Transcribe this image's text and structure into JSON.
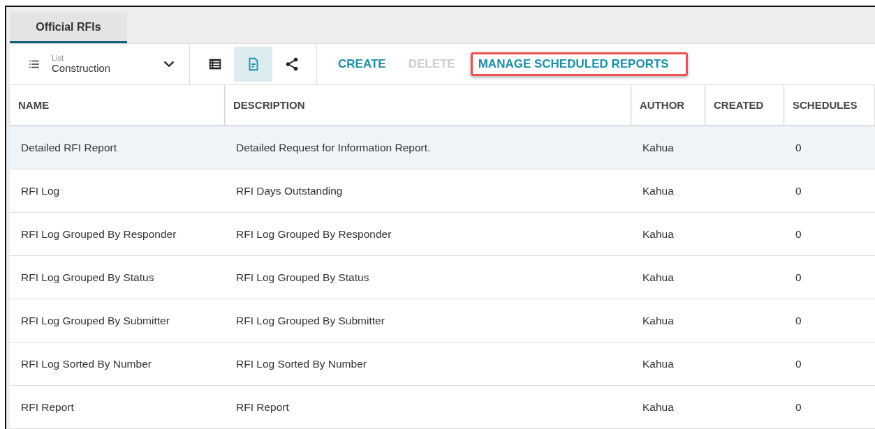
{
  "tabs": [
    {
      "label": "Official RFIs",
      "selected": true
    }
  ],
  "view_picker": {
    "caption": "List",
    "value": "Construction"
  },
  "view_buttons": [
    {
      "kind": "table",
      "selected": false
    },
    {
      "kind": "report",
      "selected": true
    },
    {
      "kind": "share",
      "selected": false
    }
  ],
  "actions": [
    {
      "label": "CREATE",
      "disabled": false,
      "highlighted": false
    },
    {
      "label": "DELETE",
      "disabled": true,
      "highlighted": false
    },
    {
      "label": "MANAGE SCHEDULED REPORTS",
      "disabled": false,
      "highlighted": true
    }
  ],
  "table": {
    "columns": [
      "NAME",
      "DESCRIPTION",
      "AUTHOR",
      "CREATED",
      "SCHEDULES"
    ],
    "rows": [
      {
        "name": "Detailed RFI Report",
        "description": "Detailed Request for Information Report.",
        "author": "Kahua",
        "schedules": "0",
        "selected": true
      },
      {
        "name": "RFI Log",
        "description": "RFI Days Outstanding",
        "author": "Kahua",
        "schedules": "0",
        "selected": false
      },
      {
        "name": "RFI Log Grouped By Responder",
        "description": "RFI Log Grouped By Responder",
        "author": "Kahua",
        "schedules": "0",
        "selected": false
      },
      {
        "name": "RFI Log Grouped By Status",
        "description": "RFI Log Grouped By Status",
        "author": "Kahua",
        "schedules": "0",
        "selected": false
      },
      {
        "name": "RFI Log Grouped By Submitter",
        "description": "RFI Log Grouped By Submitter",
        "author": "Kahua",
        "schedules": "0",
        "selected": false
      },
      {
        "name": "RFI Log Sorted By Number",
        "description": "RFI Log Sorted By Number",
        "author": "Kahua",
        "schedules": "0",
        "selected": false
      },
      {
        "name": "RFI Report",
        "description": "RFI Report",
        "author": "Kahua",
        "schedules": "0",
        "selected": false
      }
    ]
  }
}
